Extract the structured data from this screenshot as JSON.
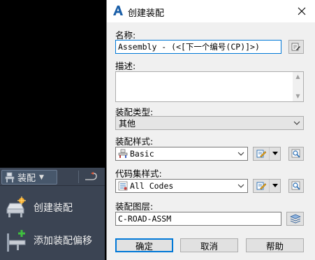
{
  "ribbon": {
    "dropdown_label": "装配",
    "items": [
      {
        "label": "创建装配",
        "icon": "create-assembly-icon"
      },
      {
        "label": "添加装配偏移",
        "icon": "add-assembly-offset-icon"
      }
    ]
  },
  "dialog": {
    "title": "创建装配",
    "name_label": "名称:",
    "name_value": "Assembly - (<[下一个编号(CP)]>)",
    "description_label": "描述:",
    "description_value": "",
    "type_label": "装配类型:",
    "type_value": "其他",
    "style_label": "装配样式:",
    "style_value": "Basic",
    "codeset_label": "代码集样式:",
    "codeset_value": "All Codes",
    "layer_label": "装配图层:",
    "layer_value": "C-ROAD-ASSM",
    "ok_label": "确定",
    "cancel_label": "取消",
    "help_label": "帮助"
  },
  "colors": {
    "accent": "#0078d7",
    "dialog_bg": "#f0f0f0",
    "ribbon_bg": "#3b4453"
  }
}
